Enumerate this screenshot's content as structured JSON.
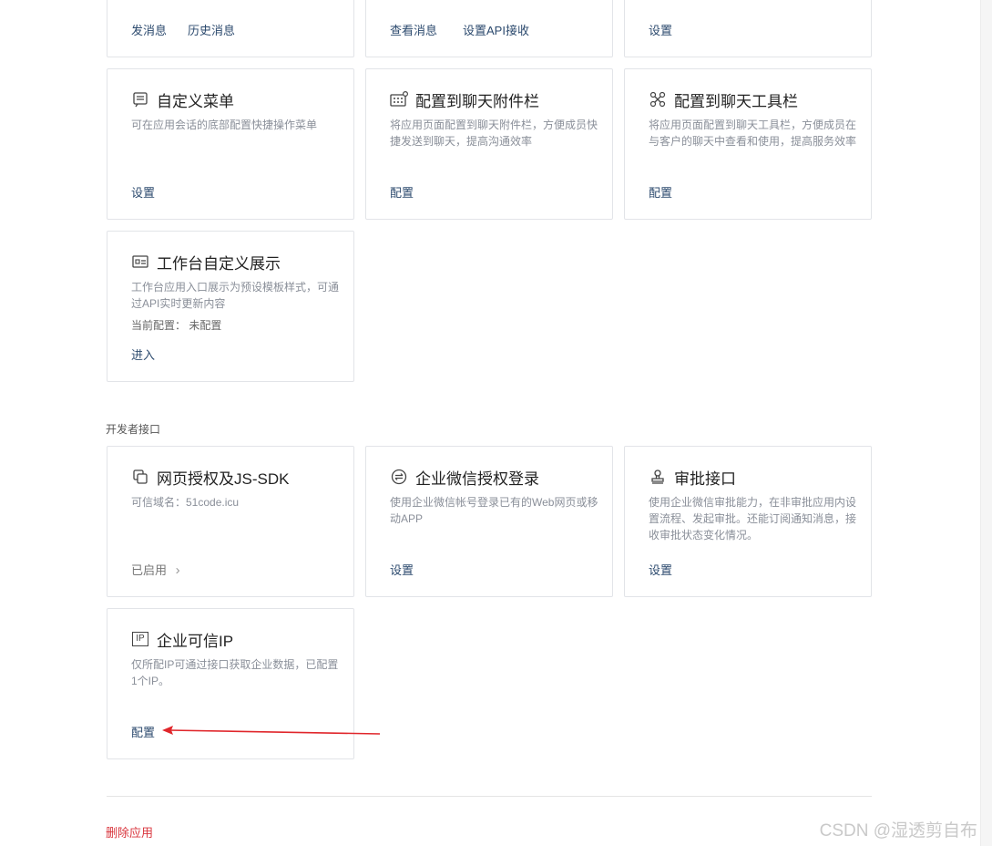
{
  "top_row": {
    "card1": {
      "link1": "发消息",
      "link2": "历史消息"
    },
    "card2": {
      "link1": "查看消息",
      "link2": "设置API接收"
    },
    "card3": {
      "link1": "设置"
    }
  },
  "custom_menu": {
    "title": "自定义菜单",
    "desc": "可在应用会话的底部配置快捷操作菜单",
    "action": "设置"
  },
  "chat_attachment": {
    "title": "配置到聊天附件栏",
    "desc": "将应用页面配置到聊天附件栏，方便成员快捷发送到聊天，提高沟通效率",
    "action": "配置"
  },
  "chat_toolbar": {
    "title": "配置到聊天工具栏",
    "desc": "将应用页面配置到聊天工具栏，方便成员在与客户的聊天中查看和使用，提高服务效率",
    "action": "配置"
  },
  "workbench": {
    "title": "工作台自定义展示",
    "desc": "工作台应用入口展示为预设模板样式，可通过API实时更新内容",
    "current": "当前配置： 未配置",
    "action": "进入"
  },
  "developer_section": {
    "label": "开发者接口"
  },
  "web_auth": {
    "title": "网页授权及JS-SDK",
    "desc": "可信域名：51code.icu",
    "status": "已启用",
    "chevron": "›"
  },
  "wecom_login": {
    "title": "企业微信授权登录",
    "desc": "使用企业微信帐号登录已有的Web网页或移动APP",
    "action": "设置"
  },
  "approval": {
    "title": "审批接口",
    "desc": "使用企业微信审批能力，在非审批应用内设置流程、发起审批。还能订阅通知消息，接收审批状态变化情况。",
    "action": "设置"
  },
  "trusted_ip": {
    "title": "企业可信IP",
    "icon_text": "IP",
    "desc": "仅所配IP可通过接口获取企业数据，已配置1个IP。",
    "action": "配置"
  },
  "footer": {
    "delete_label": "删除应用"
  },
  "watermark": "CSDN @湿透剪自布",
  "colors": {
    "link": "#2c4a6e",
    "danger": "#d9363e",
    "arrow": "#e0262b",
    "border": "#e2e4e8"
  }
}
